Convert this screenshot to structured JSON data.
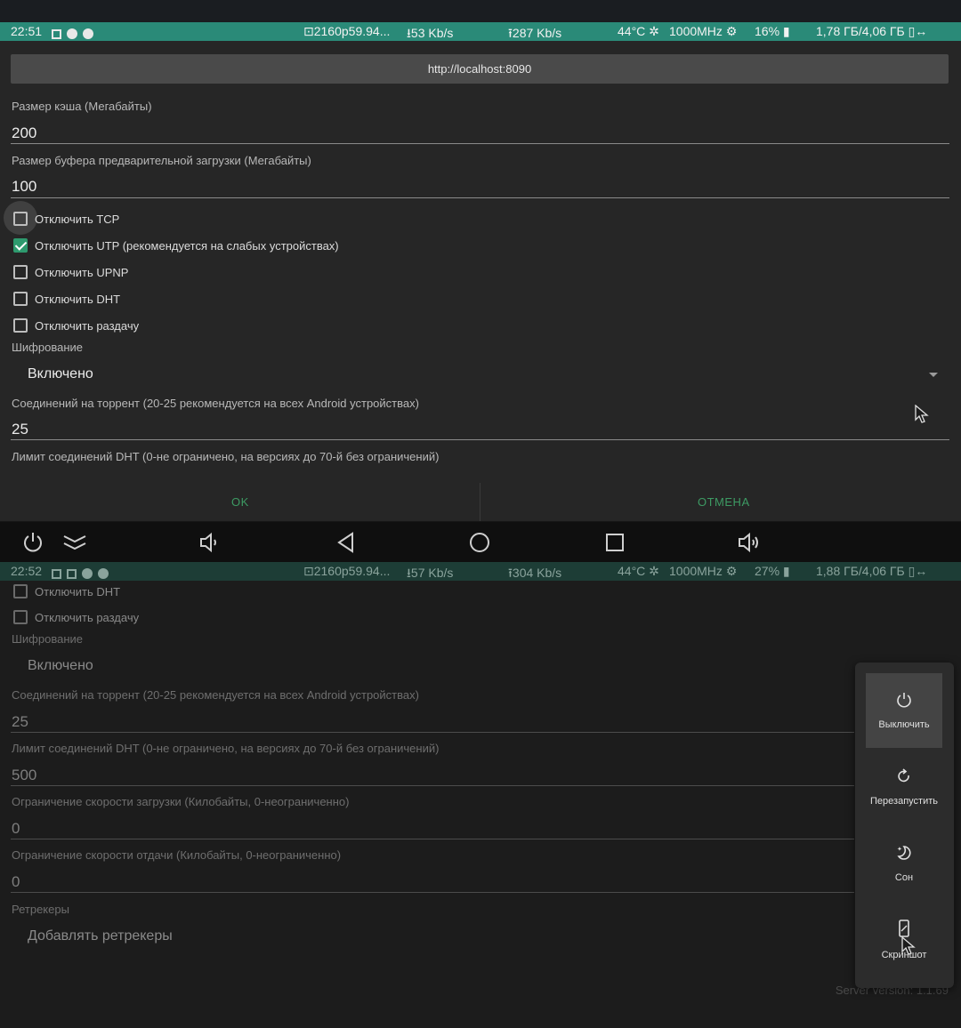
{
  "top_status": {
    "time": "22:51",
    "video": "2160p59.94...",
    "download": "53 Kb/s",
    "upload": "287 Kb/s",
    "temp": "44°C",
    "freq": "1000MHz",
    "cpu": "16%",
    "memory": "1,78 ГБ/4,06 ГБ"
  },
  "dialog": {
    "url_button": "http://localhost:8090",
    "cache_label": "Размер кэша (Мегабайты)",
    "cache_value": "200",
    "buffer_label": "Размер буфера предварительной загрузки (Мегабайты)",
    "buffer_value": "100",
    "checkboxes": [
      {
        "label": "Отключить TCP",
        "checked": false
      },
      {
        "label": "Отключить UTP (рекомендуется на слабых устройствах)",
        "checked": true
      },
      {
        "label": "Отключить UPNP",
        "checked": false
      },
      {
        "label": "Отключить DHT",
        "checked": false
      },
      {
        "label": "Отключить раздачу",
        "checked": false
      }
    ],
    "encryption_label": "Шифрование",
    "encryption_value": "Включено",
    "connections_label": "Соединений на торрент (20-25 рекомендуется на всех Android устройствах)",
    "connections_value": "25",
    "dht_limit_label": "Лимит соединений DHT (0-не ограничено, на версиях до 70-й без ограничений)",
    "ok_label": "OK",
    "cancel_label": "ОТМЕНА"
  },
  "bottom_status": {
    "time": "22:52",
    "video": "2160p59.94...",
    "download": "57 Kb/s",
    "upload": "304 Kb/s",
    "temp": "44°C",
    "freq": "1000MHz",
    "cpu": "27%",
    "memory": "1,88 ГБ/4,06 ГБ"
  },
  "lower": {
    "cb_dht": "Отключить DHT",
    "cb_seed": "Отключить раздачу",
    "encryption_label": "Шифрование",
    "encryption_value": "Включено",
    "connections_label": "Соединений на торрент (20-25 рекомендуется на всех Android устройствах)",
    "connections_value": "25",
    "dht_limit_label": "Лимит соединений DHT (0-не ограничено, на версиях до 70-й без ограничений)",
    "dht_limit_value": "500",
    "dl_limit_label": "Ограничение скорости загрузки (Килобайты, 0-неограниченно)",
    "dl_limit_value": "0",
    "ul_limit_label": "Ограничение скорости отдачи (Килобайты, 0-неограниченно)",
    "ul_limit_value": "0",
    "retrackers_label": "Ретрекеры",
    "retrackers_value": "Добавлять ретрекеры",
    "server_version": "Server version: 1.1.69"
  },
  "power_menu": {
    "shutdown": "Выключить",
    "restart": "Перезапустить",
    "sleep": "Сон",
    "screenshot": "Скриншот"
  },
  "colors": {
    "status_bar": "#2a8a78",
    "accent_green": "#3d9a63",
    "checkbox_checked": "#2e9a6e"
  }
}
